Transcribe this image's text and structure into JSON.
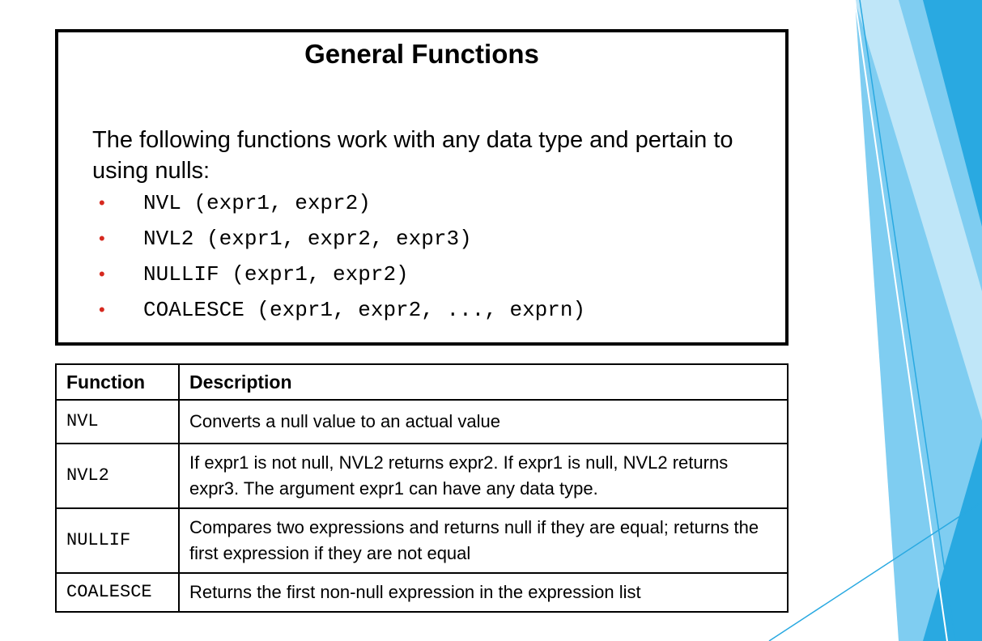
{
  "slide": {
    "title": "General Functions",
    "intro": "The following functions work with any data type and pertain to using nulls:",
    "bullets": [
      "NVL (expr1, expr2)",
      "NVL2 (expr1, expr2, expr3)",
      "NULLIF (expr1, expr2)",
      "COALESCE (expr1, expr2, ..., exprn)"
    ],
    "bullet_color": "#d6291f",
    "accent_colors": [
      "#29a9e1",
      "#7fcdf1",
      "#bfe6f8"
    ]
  },
  "table": {
    "headers": [
      "Function",
      "Description"
    ],
    "rows": [
      {
        "name": "NVL",
        "description": "Converts a null value to an actual value"
      },
      {
        "name": "NVL2",
        "description": "If expr1 is not null, NVL2 returns expr2. If expr1 is null, NVL2 returns expr3. The argument expr1 can have any data type."
      },
      {
        "name": "NULLIF",
        "description": "Compares two expressions and returns null if they are equal; returns the first expression if they are not equal"
      },
      {
        "name": "COALESCE",
        "description": "Returns the first non-null expression in the expression list"
      }
    ]
  }
}
